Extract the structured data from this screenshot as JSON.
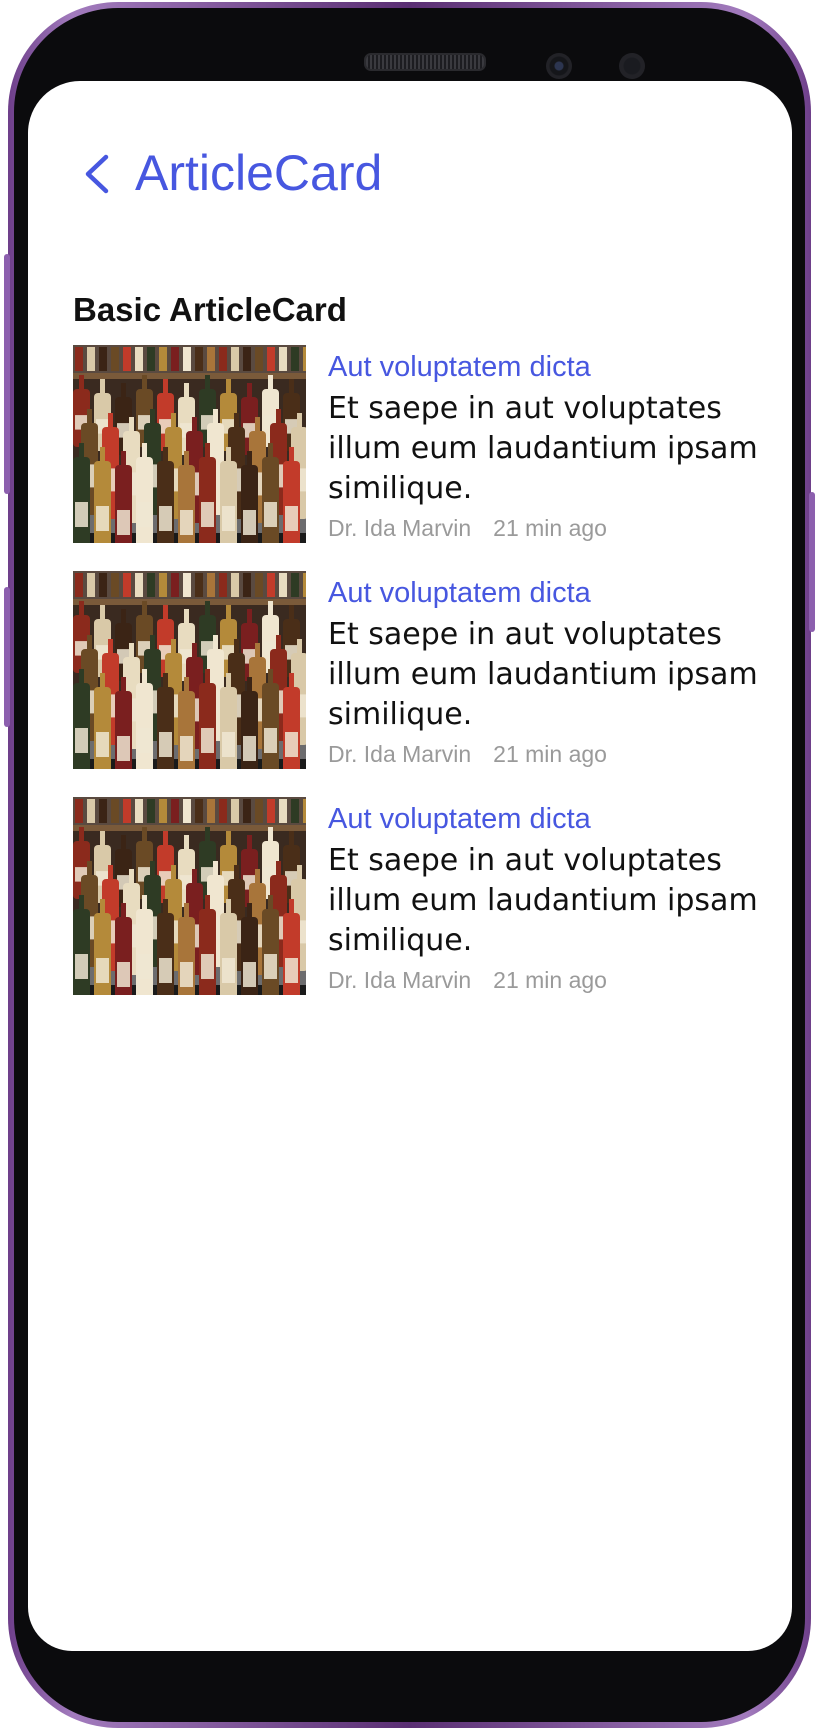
{
  "header": {
    "back_icon": "chevron-left-icon",
    "title": "ArticleCard"
  },
  "section": {
    "title": "Basic ArticleCard"
  },
  "articles": [
    {
      "image": "bottles-on-bar-photo",
      "kicker": "Aut voluptatem dicta",
      "headline": "Et saepe in aut voluptates illum eum laudantium ipsam similique.",
      "author": "Dr. Ida Marvin",
      "time": "21 min ago"
    },
    {
      "image": "bottles-on-bar-photo",
      "kicker": "Aut voluptatem dicta",
      "headline": "Et saepe in aut voluptates illum eum laudantium ipsam similique.",
      "author": "Dr. Ida Marvin",
      "time": "21 min ago"
    },
    {
      "image": "bottles-on-bar-photo",
      "kicker": "Aut voluptatem dicta",
      "headline": "Et saepe in aut voluptates illum eum laudantium ipsam similique.",
      "author": "Dr. Ida Marvin",
      "time": "21 min ago"
    }
  ],
  "colors": {
    "accent": "#4757e0",
    "text": "#111111",
    "meta": "#9a9a9a",
    "device_frame": "#6e3f8a"
  }
}
